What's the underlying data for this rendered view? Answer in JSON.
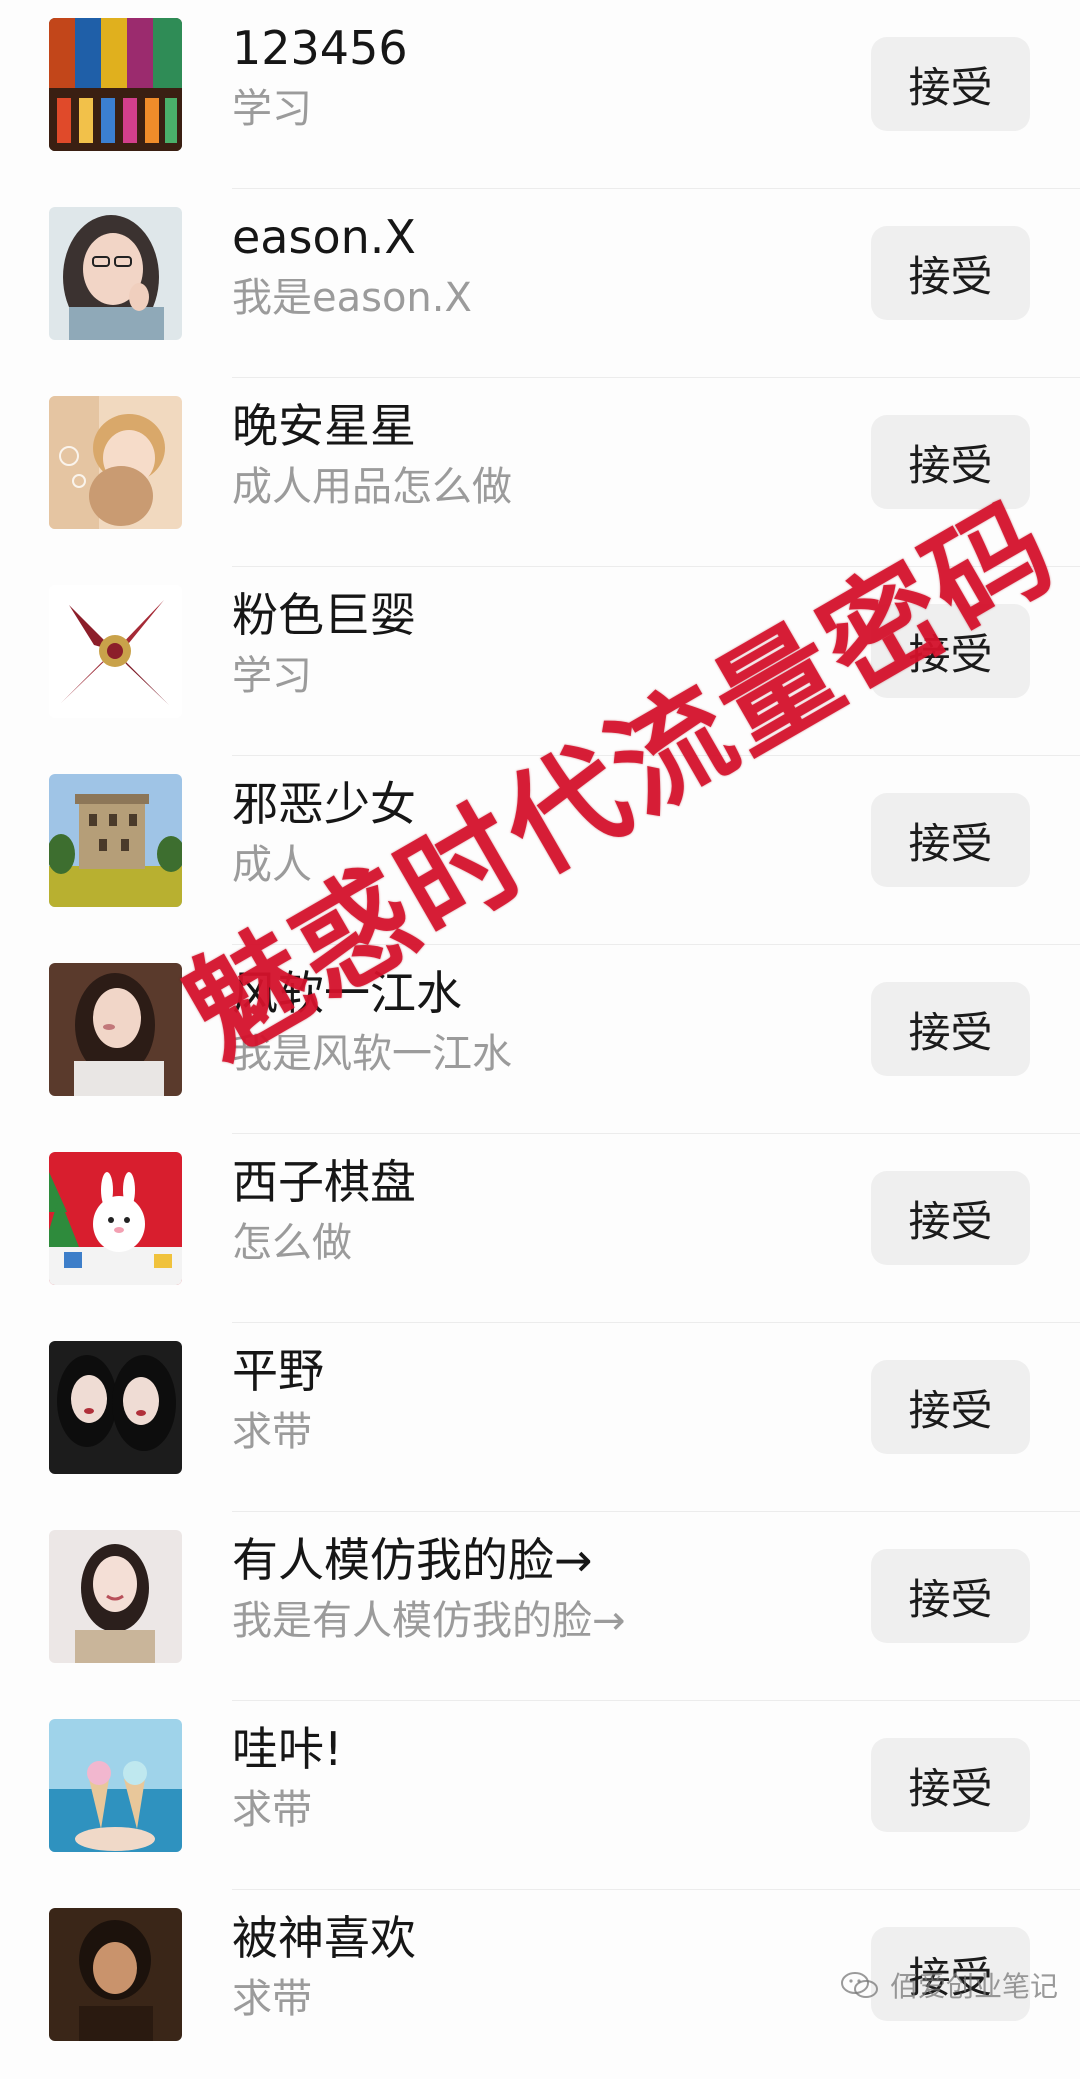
{
  "requests": [
    {
      "name": "123456",
      "message": "学习",
      "accept_label": "接受",
      "avatar": "stained-glass-avatar"
    },
    {
      "name": "eason.X",
      "message": "我是eason.X",
      "accept_label": "接受",
      "avatar": "girl-glasses-avatar"
    },
    {
      "name": "晚安星星",
      "message": "成人用品怎么做",
      "accept_label": "接受",
      "avatar": "child-bubbles-avatar"
    },
    {
      "name": "粉色巨婴",
      "message": "学习",
      "accept_label": "接受",
      "avatar": "scarf-avatar"
    },
    {
      "name": "邪恶少女",
      "message": "成人",
      "accept_label": "接受",
      "avatar": "tower-field-avatar"
    },
    {
      "name": "风软一江水",
      "message": "我是风软一江水",
      "accept_label": "接受",
      "avatar": "woman-portrait-avatar"
    },
    {
      "name": "西子棋盘",
      "message": "怎么做",
      "accept_label": "接受",
      "avatar": "christmas-bunny-avatar"
    },
    {
      "name": "平野",
      "message": "求带",
      "accept_label": "接受",
      "avatar": "two-girls-avatar"
    },
    {
      "name": "有人模仿我的脸→",
      "message": "我是有人模仿我的脸→",
      "accept_label": "接受",
      "avatar": "smiling-woman-avatar"
    },
    {
      "name": "哇咔!",
      "message": "求带",
      "accept_label": "接受",
      "avatar": "ice-cream-beach-avatar"
    },
    {
      "name": "被神喜欢",
      "message": "求带",
      "accept_label": "接受",
      "avatar": "dark-portrait-avatar"
    }
  ],
  "overlay": {
    "stamp_text": "魅惑时代流量密码",
    "watermark_text": "佰爱创业笔记",
    "stamp_color": "#d6122d"
  }
}
